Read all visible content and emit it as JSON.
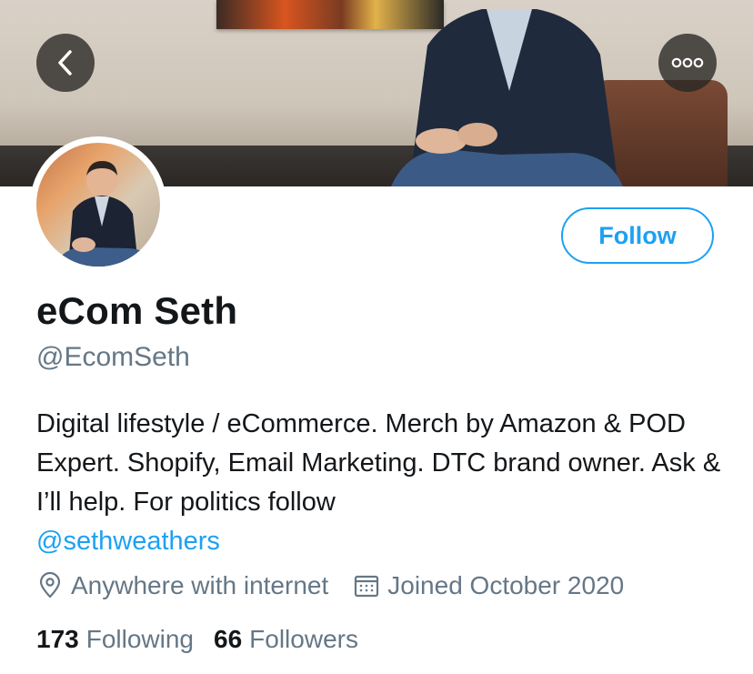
{
  "profile": {
    "display_name": "eCom Seth",
    "handle": "@EcomSeth",
    "bio_text": "Digital lifestyle / eCommerce. Merch by Amazon & POD Expert. Shopify, Email Marketing. DTC brand owner. Ask & I’ll help. For politics follow",
    "bio_link": "@sethweathers",
    "location": "Anywhere with internet",
    "joined": "Joined October 2020"
  },
  "actions": {
    "follow_label": "Follow"
  },
  "stats": {
    "following_count": "173",
    "following_label": "Following",
    "followers_count": "66",
    "followers_label": "Followers"
  },
  "icons": {
    "back": "chevron-left-icon",
    "more": "more-horizontal-icon",
    "location": "location-pin-icon",
    "calendar": "calendar-icon"
  },
  "colors": {
    "accent": "#1da1f2",
    "secondary_text": "#657786",
    "primary_text": "#14171a"
  }
}
